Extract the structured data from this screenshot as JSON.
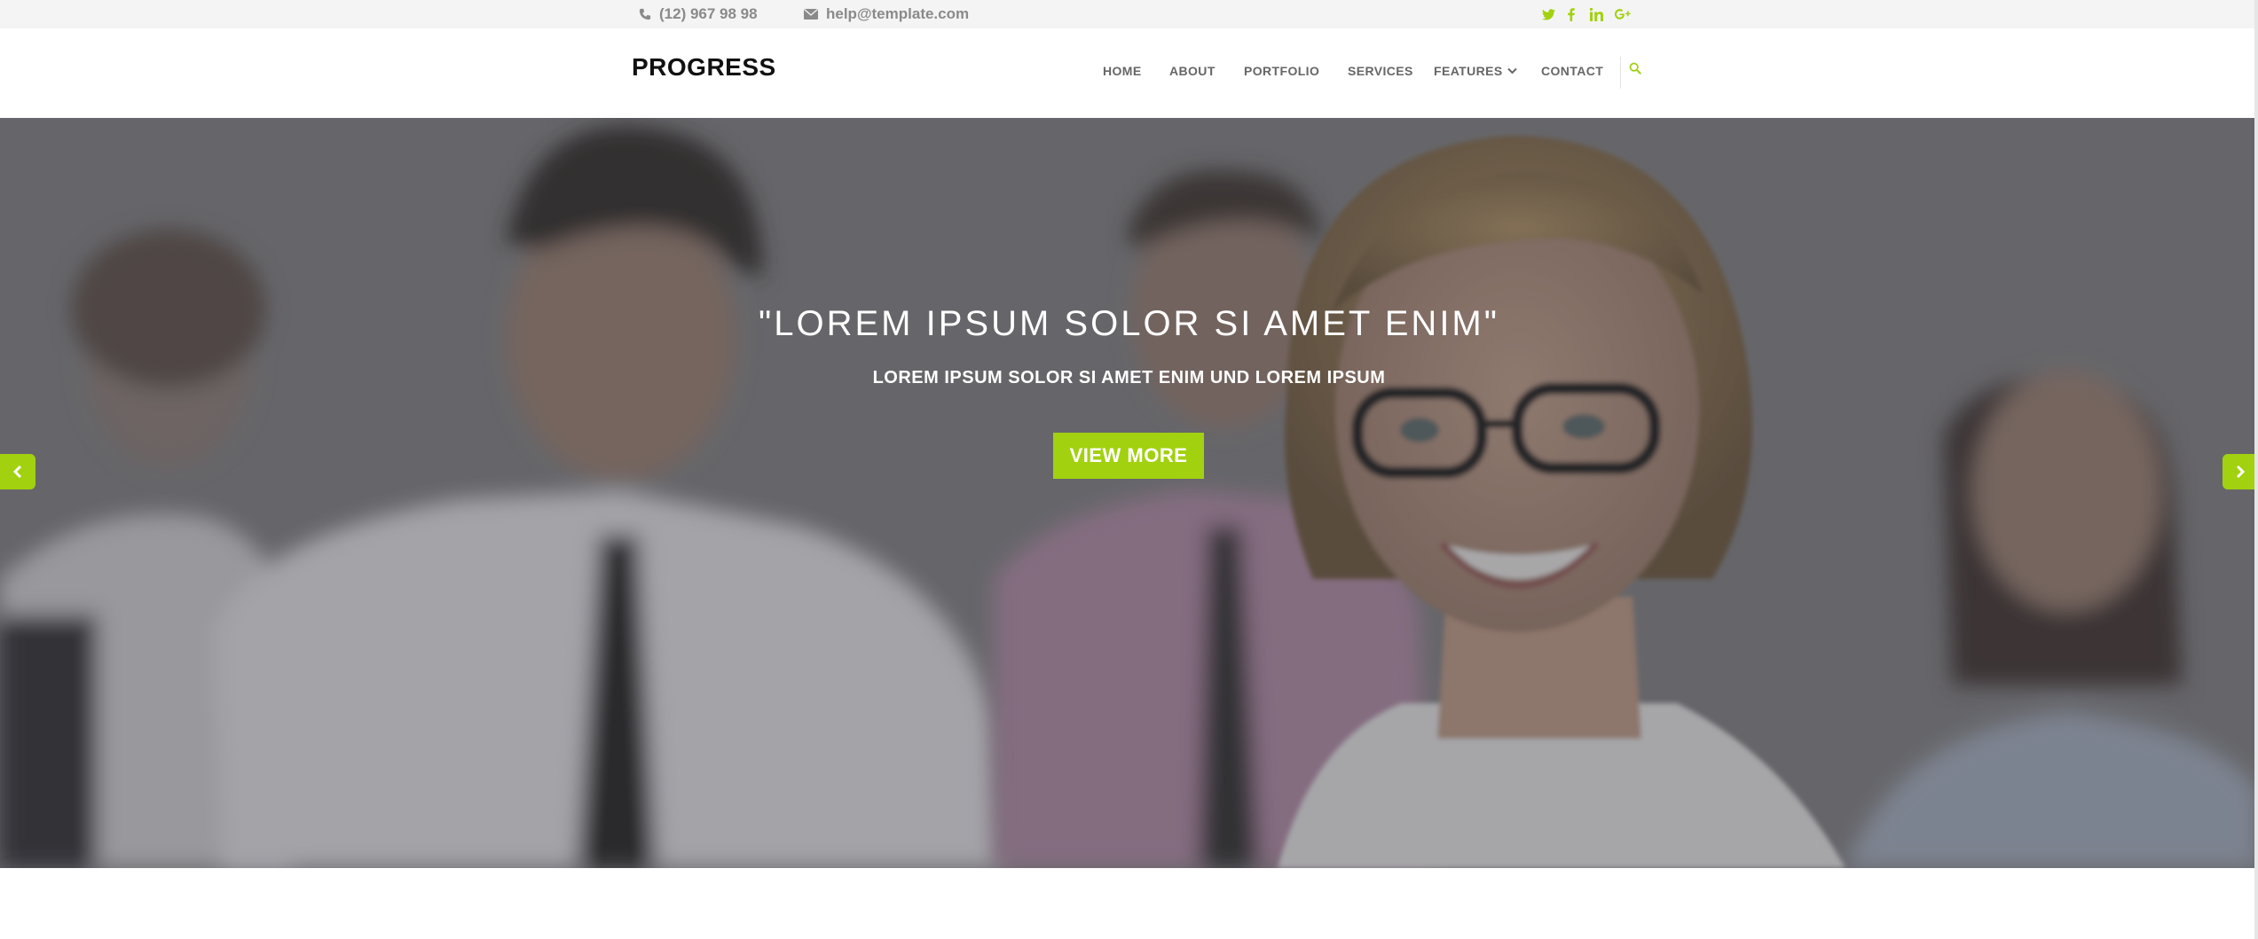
{
  "topbar": {
    "phone": "(12) 967 98 98",
    "email": "help@template.com",
    "social": [
      {
        "icon": "twitter-icon",
        "glyph": "t"
      },
      {
        "icon": "facebook-icon",
        "glyph": "f"
      },
      {
        "icon": "linkedin-icon",
        "glyph": "in"
      },
      {
        "icon": "google-plus-icon",
        "glyph": "g+"
      }
    ]
  },
  "header": {
    "logo": "PROGRESS",
    "nav": [
      "HOME",
      "ABOUT",
      "PORTFOLIO",
      "SERVICES",
      "FEATURES",
      "CONTACT"
    ]
  },
  "hero": {
    "title": "\"LOREM IPSUM SOLOR SI AMET ENIM\"",
    "subtitle": "LOREM IPSUM SOLOR SI AMET ENIM UND LOREM IPSUM",
    "button": "VIEW MORE"
  },
  "colors": {
    "accent": "#a2d10f",
    "topbar_bg": "#f4f4f4",
    "nav_text": "#666666"
  }
}
